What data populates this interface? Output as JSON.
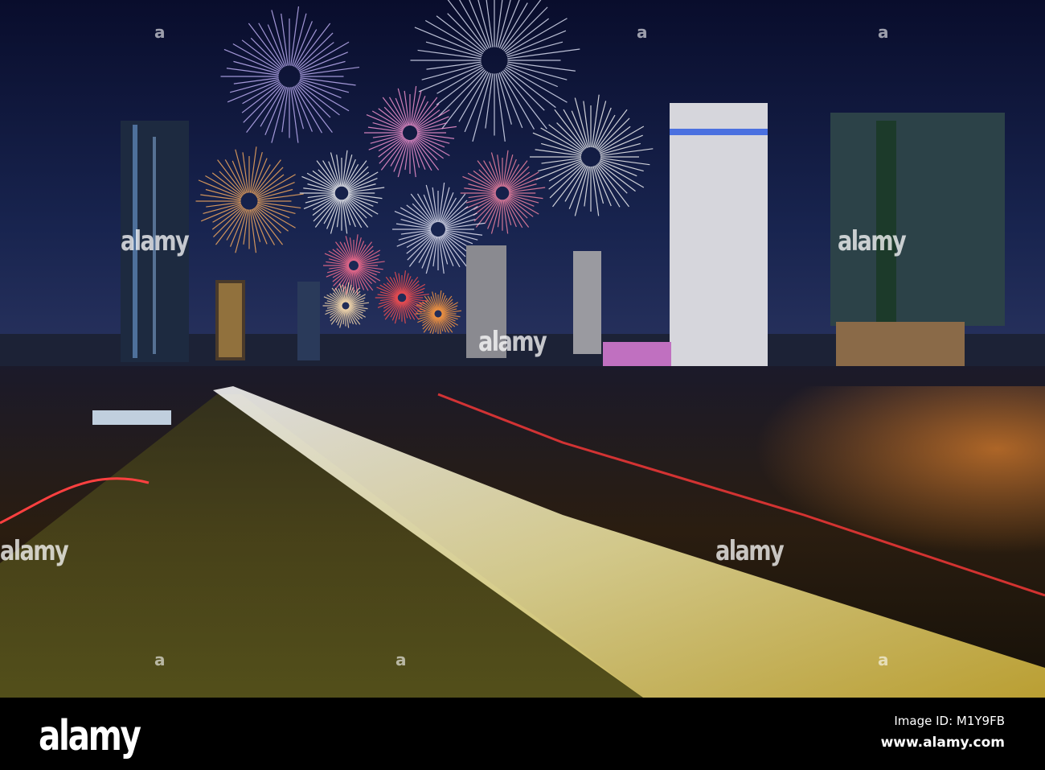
{
  "watermark": "alamy",
  "watermark_mark": "a",
  "footer": {
    "logo": "alamy",
    "image_id": "Image ID: M1Y9FB",
    "site": "www.alamy.com"
  },
  "colors": {
    "sky_top": "#0b1033",
    "sky_bottom": "#1b2a5a",
    "water": "#1a140c",
    "trail_gold": "#e8c84a"
  }
}
